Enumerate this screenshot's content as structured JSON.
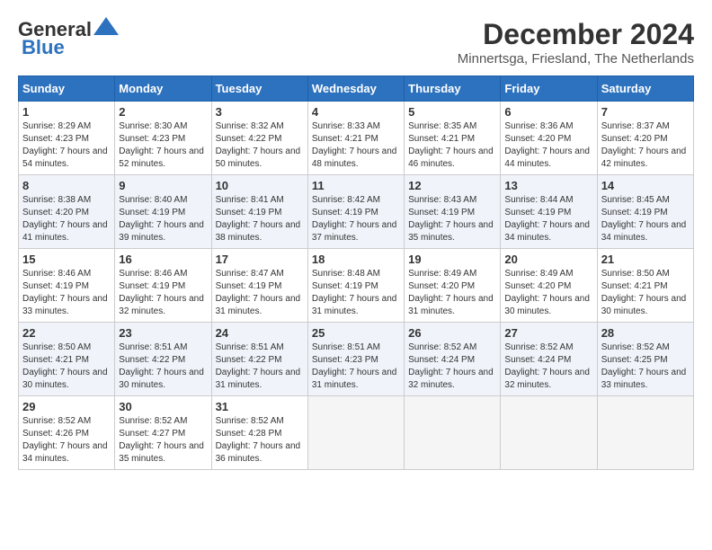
{
  "logo": {
    "line1": "General",
    "line2": "Blue"
  },
  "title": "December 2024",
  "location": "Minnertsga, Friesland, The Netherlands",
  "weekdays": [
    "Sunday",
    "Monday",
    "Tuesday",
    "Wednesday",
    "Thursday",
    "Friday",
    "Saturday"
  ],
  "weeks": [
    [
      {
        "day": "1",
        "sunrise": "8:29 AM",
        "sunset": "4:23 PM",
        "daylight": "7 hours and 54 minutes."
      },
      {
        "day": "2",
        "sunrise": "8:30 AM",
        "sunset": "4:23 PM",
        "daylight": "7 hours and 52 minutes."
      },
      {
        "day": "3",
        "sunrise": "8:32 AM",
        "sunset": "4:22 PM",
        "daylight": "7 hours and 50 minutes."
      },
      {
        "day": "4",
        "sunrise": "8:33 AM",
        "sunset": "4:21 PM",
        "daylight": "7 hours and 48 minutes."
      },
      {
        "day": "5",
        "sunrise": "8:35 AM",
        "sunset": "4:21 PM",
        "daylight": "7 hours and 46 minutes."
      },
      {
        "day": "6",
        "sunrise": "8:36 AM",
        "sunset": "4:20 PM",
        "daylight": "7 hours and 44 minutes."
      },
      {
        "day": "7",
        "sunrise": "8:37 AM",
        "sunset": "4:20 PM",
        "daylight": "7 hours and 42 minutes."
      }
    ],
    [
      {
        "day": "8",
        "sunrise": "8:38 AM",
        "sunset": "4:20 PM",
        "daylight": "7 hours and 41 minutes."
      },
      {
        "day": "9",
        "sunrise": "8:40 AM",
        "sunset": "4:19 PM",
        "daylight": "7 hours and 39 minutes."
      },
      {
        "day": "10",
        "sunrise": "8:41 AM",
        "sunset": "4:19 PM",
        "daylight": "7 hours and 38 minutes."
      },
      {
        "day": "11",
        "sunrise": "8:42 AM",
        "sunset": "4:19 PM",
        "daylight": "7 hours and 37 minutes."
      },
      {
        "day": "12",
        "sunrise": "8:43 AM",
        "sunset": "4:19 PM",
        "daylight": "7 hours and 35 minutes."
      },
      {
        "day": "13",
        "sunrise": "8:44 AM",
        "sunset": "4:19 PM",
        "daylight": "7 hours and 34 minutes."
      },
      {
        "day": "14",
        "sunrise": "8:45 AM",
        "sunset": "4:19 PM",
        "daylight": "7 hours and 34 minutes."
      }
    ],
    [
      {
        "day": "15",
        "sunrise": "8:46 AM",
        "sunset": "4:19 PM",
        "daylight": "7 hours and 33 minutes."
      },
      {
        "day": "16",
        "sunrise": "8:46 AM",
        "sunset": "4:19 PM",
        "daylight": "7 hours and 32 minutes."
      },
      {
        "day": "17",
        "sunrise": "8:47 AM",
        "sunset": "4:19 PM",
        "daylight": "7 hours and 31 minutes."
      },
      {
        "day": "18",
        "sunrise": "8:48 AM",
        "sunset": "4:19 PM",
        "daylight": "7 hours and 31 minutes."
      },
      {
        "day": "19",
        "sunrise": "8:49 AM",
        "sunset": "4:20 PM",
        "daylight": "7 hours and 31 minutes."
      },
      {
        "day": "20",
        "sunrise": "8:49 AM",
        "sunset": "4:20 PM",
        "daylight": "7 hours and 30 minutes."
      },
      {
        "day": "21",
        "sunrise": "8:50 AM",
        "sunset": "4:21 PM",
        "daylight": "7 hours and 30 minutes."
      }
    ],
    [
      {
        "day": "22",
        "sunrise": "8:50 AM",
        "sunset": "4:21 PM",
        "daylight": "7 hours and 30 minutes."
      },
      {
        "day": "23",
        "sunrise": "8:51 AM",
        "sunset": "4:22 PM",
        "daylight": "7 hours and 30 minutes."
      },
      {
        "day": "24",
        "sunrise": "8:51 AM",
        "sunset": "4:22 PM",
        "daylight": "7 hours and 31 minutes."
      },
      {
        "day": "25",
        "sunrise": "8:51 AM",
        "sunset": "4:23 PM",
        "daylight": "7 hours and 31 minutes."
      },
      {
        "day": "26",
        "sunrise": "8:52 AM",
        "sunset": "4:24 PM",
        "daylight": "7 hours and 32 minutes."
      },
      {
        "day": "27",
        "sunrise": "8:52 AM",
        "sunset": "4:24 PM",
        "daylight": "7 hours and 32 minutes."
      },
      {
        "day": "28",
        "sunrise": "8:52 AM",
        "sunset": "4:25 PM",
        "daylight": "7 hours and 33 minutes."
      }
    ],
    [
      {
        "day": "29",
        "sunrise": "8:52 AM",
        "sunset": "4:26 PM",
        "daylight": "7 hours and 34 minutes."
      },
      {
        "day": "30",
        "sunrise": "8:52 AM",
        "sunset": "4:27 PM",
        "daylight": "7 hours and 35 minutes."
      },
      {
        "day": "31",
        "sunrise": "8:52 AM",
        "sunset": "4:28 PM",
        "daylight": "7 hours and 36 minutes."
      },
      null,
      null,
      null,
      null
    ]
  ]
}
